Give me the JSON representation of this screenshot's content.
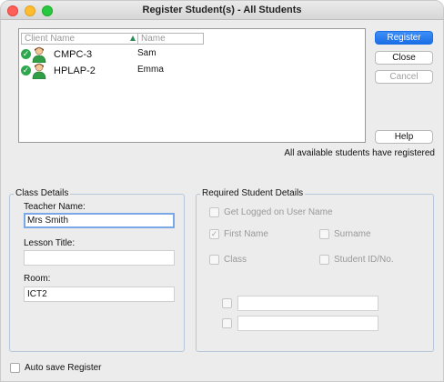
{
  "window": {
    "title": "Register Student(s) - All Students"
  },
  "client_list": {
    "columns": {
      "client_name": "Client Name",
      "name": "Name"
    },
    "rows": [
      {
        "client": "CMPC-3",
        "student": "Sam"
      },
      {
        "client": "HPLAP-2",
        "student": "Emma"
      }
    ]
  },
  "buttons": {
    "register": "Register",
    "close": "Close",
    "cancel": "Cancel",
    "help": "Help"
  },
  "status_text": "All available students have registered",
  "class_details": {
    "legend": "Class Details",
    "teacher_label": "Teacher Name:",
    "teacher_value": "Mrs Smith",
    "lesson_label": "Lesson Title:",
    "lesson_value": "",
    "room_label": "Room:",
    "room_value": "ICT2"
  },
  "required_details": {
    "legend": "Required Student Details",
    "get_logged_user": "Get Logged on User Name",
    "first_name": "First Name",
    "surname": "Surname",
    "class": "Class",
    "student_id": "Student ID/No."
  },
  "auto_save_label": "Auto save Register",
  "colors": {
    "accent": "#1b6fe6",
    "check": "#2ea84e",
    "focus": "#7aa7e8"
  }
}
